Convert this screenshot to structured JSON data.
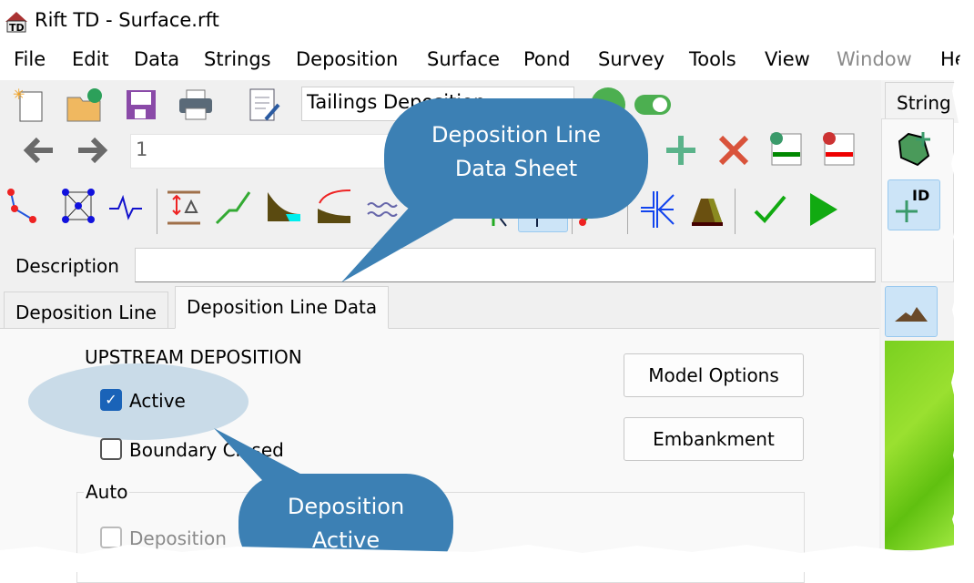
{
  "window": {
    "title": "Rift TD - Surface.rft"
  },
  "menu": [
    {
      "label": "File"
    },
    {
      "label": "Edit"
    },
    {
      "label": "Data"
    },
    {
      "label": "Strings"
    },
    {
      "label": "Deposition"
    },
    {
      "label": "Surface"
    },
    {
      "label": "Pond"
    },
    {
      "label": "Survey"
    },
    {
      "label": "Tools"
    },
    {
      "label": "View"
    },
    {
      "label": "Window",
      "disabled": true
    },
    {
      "label": "He"
    }
  ],
  "toolbar": {
    "name_value": "Tailings Deposition",
    "record_value": "1",
    "toggle_on": true
  },
  "description": {
    "label": "Description",
    "value": ""
  },
  "tabs": [
    {
      "label": "Deposition Line"
    },
    {
      "label": "Deposition Line Data",
      "active": true
    }
  ],
  "right_panel": {
    "tab": "String"
  },
  "panel": {
    "section": "UPSTREAM DEPOSITION",
    "active_label": "Active",
    "active_checked": true,
    "boundary_label": "Boundary Closed",
    "boundary_checked": false,
    "auto_group": "Auto",
    "deposition_label": "Deposition",
    "deposition_checked": false,
    "model_options": "Model Options",
    "embankment": "Embankment"
  },
  "callouts": {
    "top": "Deposition Line\nData Sheet",
    "top_l1": "Deposition Line",
    "top_l2": "Data Sheet",
    "bottom_l1": "Deposition",
    "bottom_l2": "Active"
  },
  "colors": {
    "callout": "#3c80b4",
    "highlight": "#c9dbe8",
    "checkbox": "#1a63b8"
  }
}
